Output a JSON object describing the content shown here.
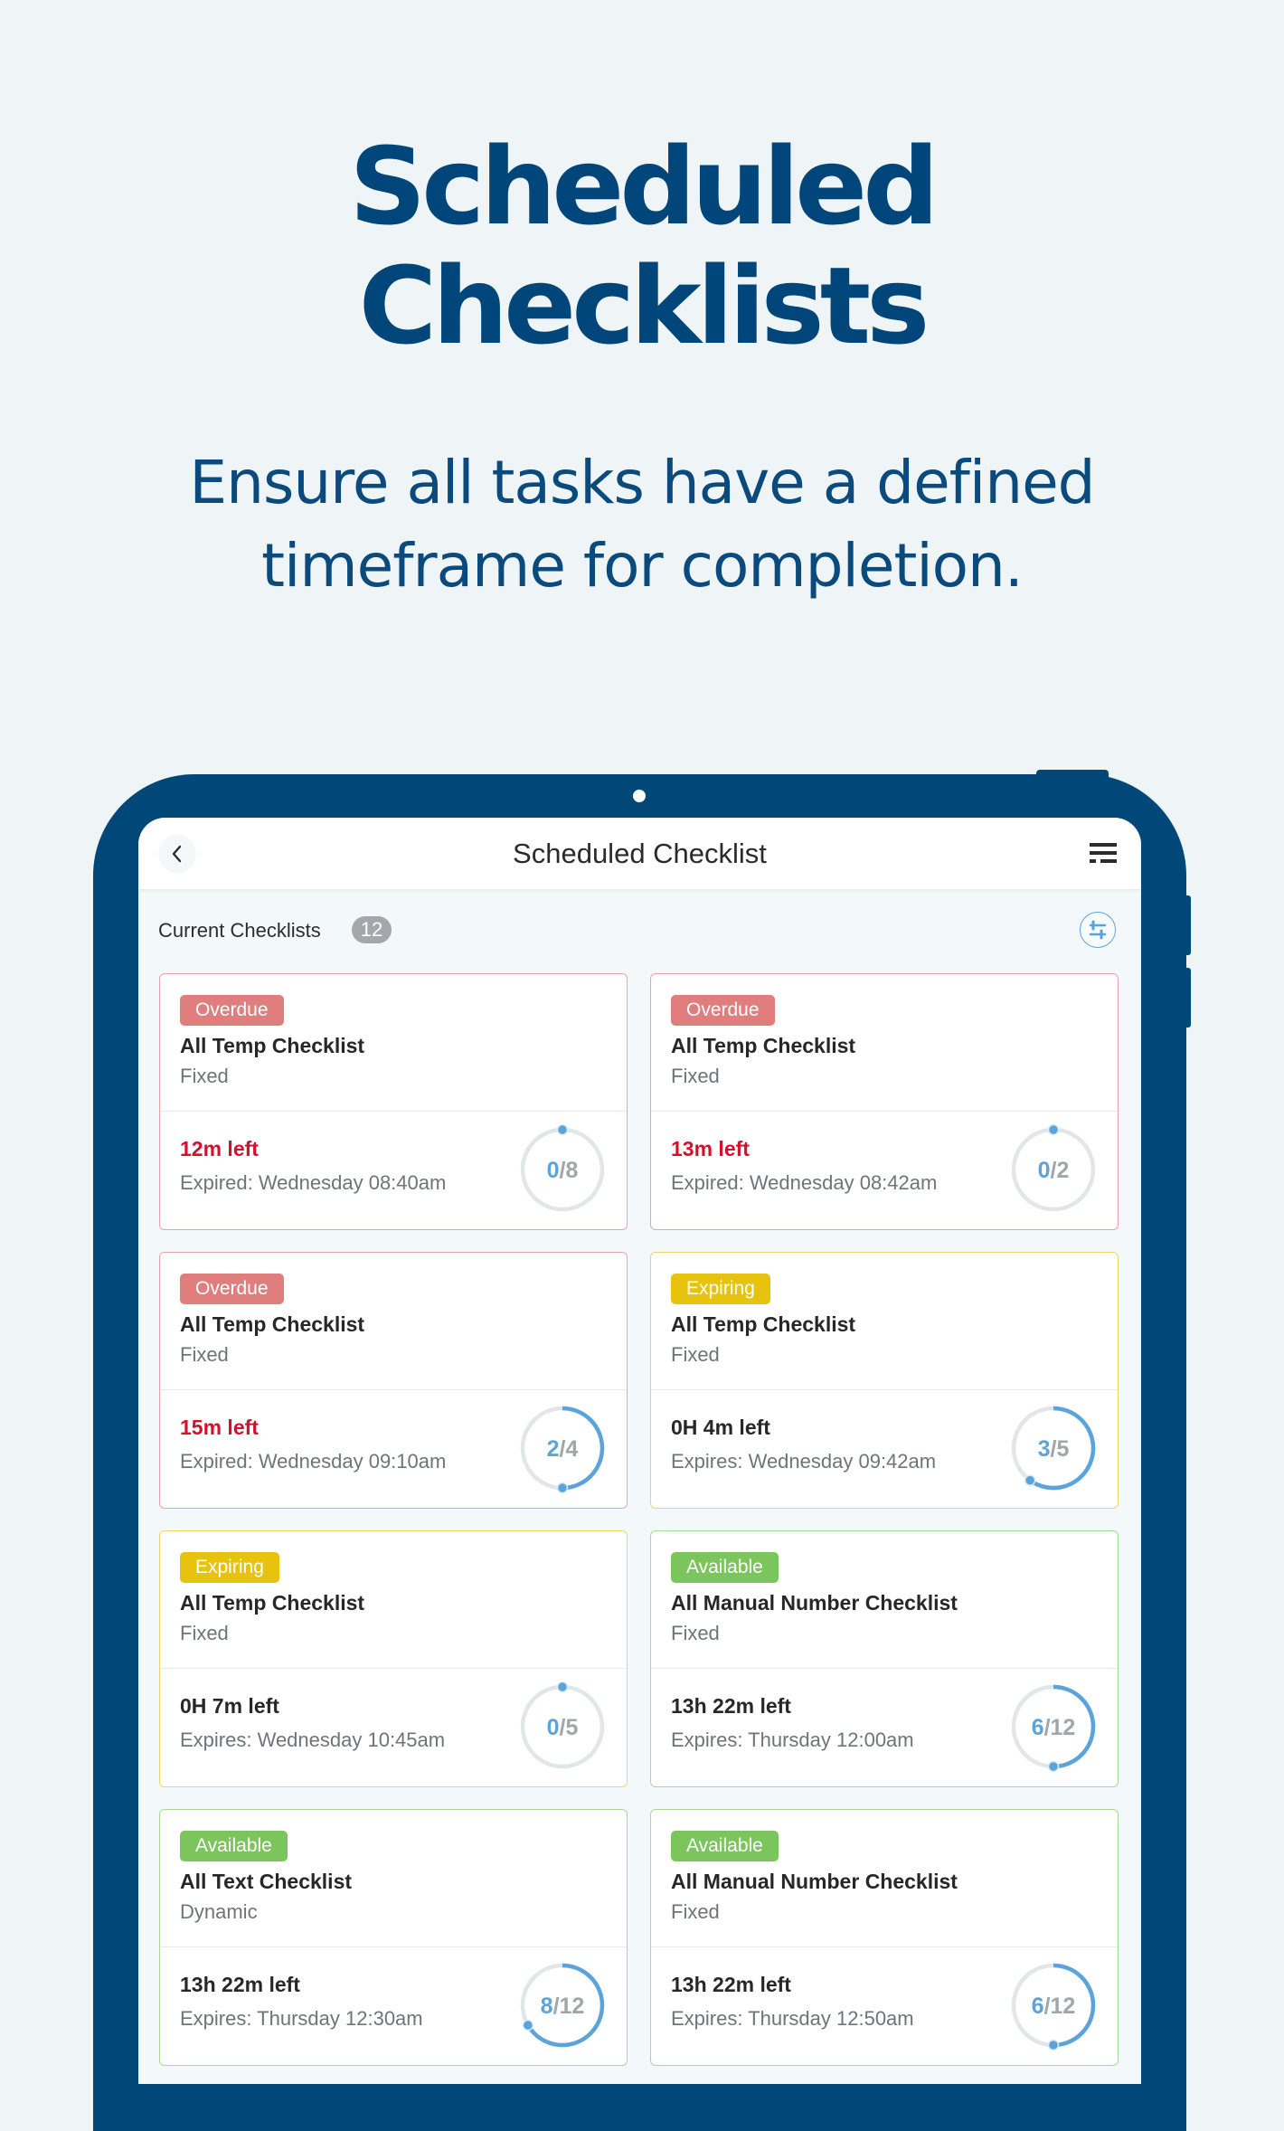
{
  "hero": {
    "title_line1": "Scheduled",
    "title_line2": "Checklists",
    "subtitle_line1": "Ensure all tasks have a defined",
    "subtitle_line2": "timeframe for completion."
  },
  "app": {
    "title": "Scheduled Checklist",
    "back_icon": "chevron-left-icon",
    "menu_icon": "list-menu-icon",
    "filter_icon": "sliders-icon"
  },
  "section": {
    "label": "Current Checklists",
    "count": "12"
  },
  "colors": {
    "brand": "#014878",
    "overdue": "#e07d7d",
    "expiring": "#e7c30e",
    "available": "#7cc45c",
    "progress": "#5ba3db",
    "track": "#e1e6e9",
    "urgent_text": "#d4102c"
  },
  "cards": [
    {
      "status": "Overdue",
      "status_type": "overdue",
      "name": "All Temp Checklist",
      "type": "Fixed",
      "time_left": "12m left",
      "time_urgent": true,
      "expiry": "Expired: Wednesday 08:40am",
      "done": 0,
      "total": 8
    },
    {
      "status": "Overdue",
      "status_type": "overdue",
      "name": "All Temp Checklist",
      "type": "Fixed",
      "time_left": "13m left",
      "time_urgent": true,
      "expiry": "Expired: Wednesday 08:42am",
      "done": 0,
      "total": 2
    },
    {
      "status": "Overdue",
      "status_type": "overdue",
      "name": "All Temp Checklist",
      "type": "Fixed",
      "time_left": "15m left",
      "time_urgent": true,
      "expiry": "Expired: Wednesday 09:10am",
      "done": 2,
      "total": 4
    },
    {
      "status": "Expiring",
      "status_type": "expiring",
      "name": "All Temp Checklist",
      "type": "Fixed",
      "time_left": "0H 4m left",
      "time_urgent": false,
      "expiry": "Expires: Wednesday 09:42am",
      "done": 3,
      "total": 5
    },
    {
      "status": "Expiring",
      "status_type": "expiring",
      "name": "All Temp Checklist",
      "type": "Fixed",
      "time_left": "0H 7m left",
      "time_urgent": false,
      "expiry": "Expires: Wednesday 10:45am",
      "done": 0,
      "total": 5
    },
    {
      "status": "Available",
      "status_type": "available",
      "name": "All Manual Number Checklist",
      "type": "Fixed",
      "time_left": "13h 22m left",
      "time_urgent": false,
      "expiry": "Expires: Thursday 12:00am",
      "done": 6,
      "total": 12
    },
    {
      "status": "Available",
      "status_type": "available",
      "name": "All Text Checklist",
      "type": "Dynamic",
      "time_left": "13h 22m left",
      "time_urgent": false,
      "expiry": "Expires: Thursday 12:30am",
      "done": 8,
      "total": 12
    },
    {
      "status": "Available",
      "status_type": "available",
      "name": "All Manual Number Checklist",
      "type": "Fixed",
      "time_left": "13h 22m left",
      "time_urgent": false,
      "expiry": "Expires: Thursday 12:50am",
      "done": 6,
      "total": 12
    }
  ]
}
